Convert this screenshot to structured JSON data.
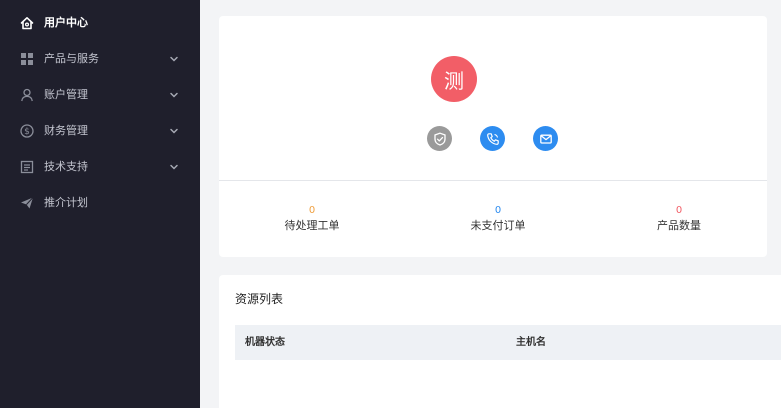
{
  "sidebar": {
    "items": [
      {
        "label": "用户中心",
        "icon": "home-icon",
        "active": true,
        "expandable": false
      },
      {
        "label": "产品与服务",
        "icon": "grid-icon",
        "active": false,
        "expandable": true
      },
      {
        "label": "账户管理",
        "icon": "user-icon",
        "active": false,
        "expandable": true
      },
      {
        "label": "财务管理",
        "icon": "dollar-icon",
        "active": false,
        "expandable": true
      },
      {
        "label": "技术支持",
        "icon": "document-icon",
        "active": false,
        "expandable": true
      },
      {
        "label": "推介计划",
        "icon": "send-icon",
        "active": false,
        "expandable": false
      }
    ]
  },
  "profile": {
    "avatar_text": "测",
    "avatar_color": "#f25e67",
    "verify_icons": [
      "shield-check-icon",
      "phone-icon",
      "mail-icon"
    ],
    "stats": [
      {
        "value": "0",
        "label": "待处理工单",
        "color": "#f0a040"
      },
      {
        "value": "0",
        "label": "未支付订单",
        "color": "#2d8cf0"
      },
      {
        "value": "0",
        "label": "产品数量",
        "color": "#f25e67"
      }
    ]
  },
  "resources": {
    "title": "资源列表",
    "columns": [
      "机器状态",
      "主机名"
    ]
  },
  "colors": {
    "sidebar_bg": "#1f1f2c",
    "page_bg": "#f3f4f6",
    "accent": "#2d8cf0"
  }
}
